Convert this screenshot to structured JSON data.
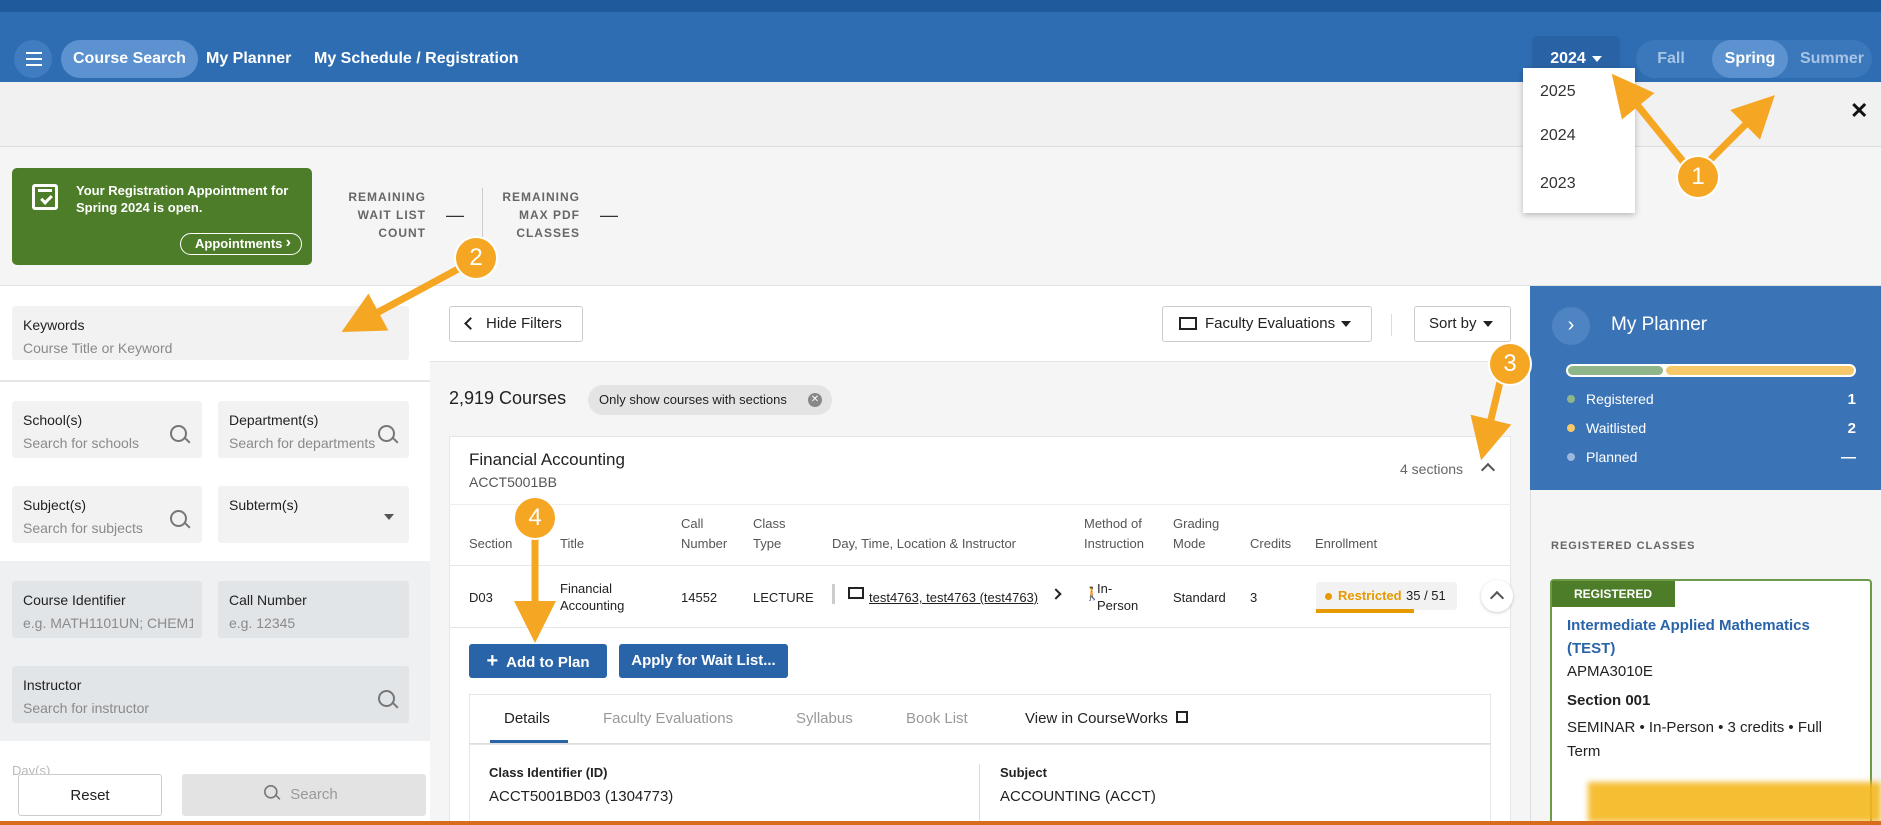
{
  "nav": {
    "course_search": "Course Search",
    "my_planner": "My Planner",
    "schedule": "My Schedule / Registration",
    "year": "2024",
    "terms": [
      "Fall",
      "Spring",
      "Summer"
    ],
    "active_term": "Spring"
  },
  "year_dropdown": [
    "2025",
    "2024",
    "2023"
  ],
  "close": "✕",
  "appointment": {
    "text": "Your Registration Appointment for Spring 2024 is open.",
    "button": "Appointments"
  },
  "stats": {
    "waitlist_label": [
      "REMAINING",
      "WAIT LIST",
      "COUNT"
    ],
    "waitlist_value": "—",
    "pdf_label": [
      "REMAINING",
      "MAX PDF",
      "CLASSES"
    ],
    "pdf_value": "—"
  },
  "filters": {
    "keywords": {
      "label": "Keywords",
      "placeholder": "Course Title or Keyword"
    },
    "schools": {
      "label": "School(s)",
      "placeholder": "Search for schools"
    },
    "departments": {
      "label": "Department(s)",
      "placeholder": "Search for departments"
    },
    "subjects": {
      "label": "Subject(s)",
      "placeholder": "Search for subjects"
    },
    "subterm": {
      "label": "Subterm(s)"
    },
    "course_identifier": {
      "label": "Course Identifier",
      "placeholder": "e.g. MATH1101UN; CHEM1:"
    },
    "call_number": {
      "label": "Call Number",
      "placeholder": "e.g. 12345"
    },
    "instructor": {
      "label": "Instructor",
      "placeholder": "Search for instructor"
    },
    "days_label": "Day(s)",
    "reset": "Reset",
    "search": "Search"
  },
  "toolbar": {
    "hide_filters": "Hide Filters",
    "faculty_evaluations": "Faculty Evaluations",
    "sort_by": "Sort by"
  },
  "results": {
    "count": "2,919 Courses",
    "chip": "Only show courses with sections"
  },
  "course": {
    "title": "Financial Accounting",
    "code": "ACCT5001BB",
    "sections": "4 sections",
    "headers": {
      "section": "Section",
      "title": "Title",
      "call_number": "Call Number",
      "class_type": "Class Type",
      "day_time": "Day, Time, Location & Instructor",
      "method": "Method of Instruction",
      "grading": "Grading Mode",
      "credits": "Credits",
      "enrollment": "Enrollment"
    },
    "row": {
      "section": "D03",
      "title": "Financial Accounting",
      "call_number": "14552",
      "class_type": "LECTURE",
      "instructor": "test4763, test4763 (test4763)",
      "method": "In-Person",
      "grading": "Standard",
      "credits": "3",
      "status": "Restricted",
      "enrolled": "35 / 51"
    },
    "add_to_plan": "Add to Plan",
    "wait_list": "Apply for Wait List...",
    "tabs": [
      "Details",
      "Faculty Evaluations",
      "Syllabus",
      "Book List",
      "View in CourseWorks"
    ],
    "details": {
      "class_id_label": "Class Identifier (ID)",
      "class_id": "ACCT5001BD03 (1304773)",
      "subject_label": "Subject",
      "subject": "ACCOUNTING (ACCT)"
    }
  },
  "planner": {
    "title": "My Planner",
    "registered_label": "Registered",
    "registered_value": "1",
    "waitlisted_label": "Waitlisted",
    "waitlisted_value": "2",
    "planned_label": "Planned",
    "planned_value": "—",
    "registered_classes": "REGISTERED CLASSES",
    "badge": "REGISTERED",
    "course": "Intermediate Applied Mathematics (TEST)",
    "code": "APMA3010E",
    "section": "Section 001",
    "detail": "SEMINAR • In-Person • 3 credits • Full Term"
  },
  "annotations": [
    "1",
    "2",
    "3",
    "4"
  ],
  "colors": {
    "brand_blue": "#2f6db3",
    "green": "#4e7d2a",
    "annotation": "#f5a623",
    "restricted": "#e69a00"
  }
}
